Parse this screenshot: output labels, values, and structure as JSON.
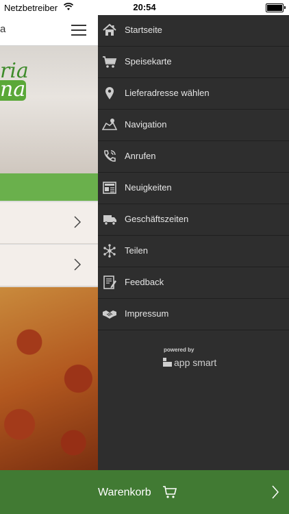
{
  "status_bar": {
    "carrier": "Netzbetreiber",
    "time": "20:54"
  },
  "app_bar": {
    "title_fragment": "a"
  },
  "logo": {
    "script_fragment": "ria",
    "word_fragment": "na"
  },
  "drawer": {
    "items": [
      {
        "label": "Startseite",
        "icon": "home-icon"
      },
      {
        "label": "Speisekarte",
        "icon": "cart-icon"
      },
      {
        "label": "Lieferadresse wählen",
        "icon": "location-pin-icon"
      },
      {
        "label": "Navigation",
        "icon": "map-icon"
      },
      {
        "label": "Anrufen",
        "icon": "phone-icon"
      },
      {
        "label": "Neuigkeiten",
        "icon": "newspaper-icon"
      },
      {
        "label": "Geschäftszeiten",
        "icon": "delivery-truck-icon"
      },
      {
        "label": "Teilen",
        "icon": "share-icon"
      },
      {
        "label": "Feedback",
        "icon": "feedback-icon"
      },
      {
        "label": "Impressum",
        "icon": "handshake-icon"
      }
    ],
    "powered_by": "powered by",
    "brand": "app smart"
  },
  "cart": {
    "label": "Warenkorb"
  },
  "colors": {
    "drawer_bg": "#2e2e2e",
    "cart_bg": "#417a33",
    "accent_green": "#6ab04c"
  }
}
